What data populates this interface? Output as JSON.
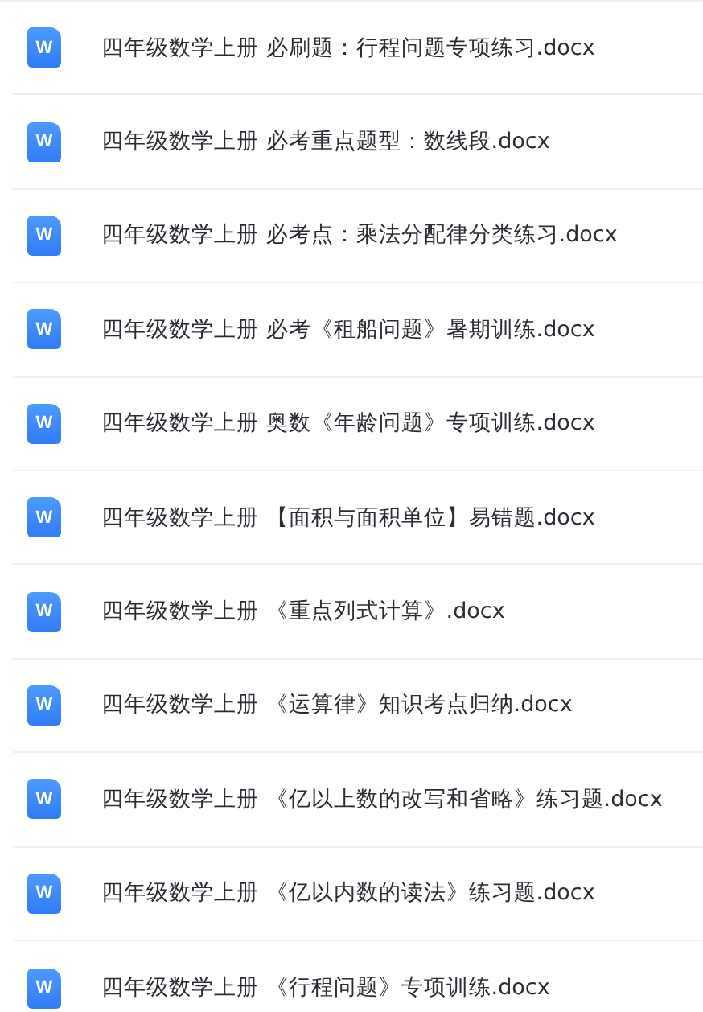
{
  "files": [
    {
      "icon_text": "W",
      "name": "四年级数学上册 必刷题：行程问题专项练习.docx"
    },
    {
      "icon_text": "W",
      "name": "四年级数学上册 必考重点题型：数线段.docx"
    },
    {
      "icon_text": "W",
      "name": "四年级数学上册 必考点：乘法分配律分类练习.docx"
    },
    {
      "icon_text": "W",
      "name": "四年级数学上册 必考《租船问题》暑期训练.docx"
    },
    {
      "icon_text": "W",
      "name": "四年级数学上册 奥数《年龄问题》专项训练.docx"
    },
    {
      "icon_text": "W",
      "name": "四年级数学上册 【面积与面积单位】易错题.docx"
    },
    {
      "icon_text": "W",
      "name": "四年级数学上册 《重点列式计算》.docx"
    },
    {
      "icon_text": "W",
      "name": "四年级数学上册 《运算律》知识考点归纳.docx"
    },
    {
      "icon_text": "W",
      "name": "四年级数学上册 《亿以上数的改写和省略》练习题.docx"
    },
    {
      "icon_text": "W",
      "name": "四年级数学上册 《亿以内数的读法》练习题.docx"
    },
    {
      "icon_text": "W",
      "name": "四年级数学上册 《行程问题》专项训练.docx"
    }
  ]
}
